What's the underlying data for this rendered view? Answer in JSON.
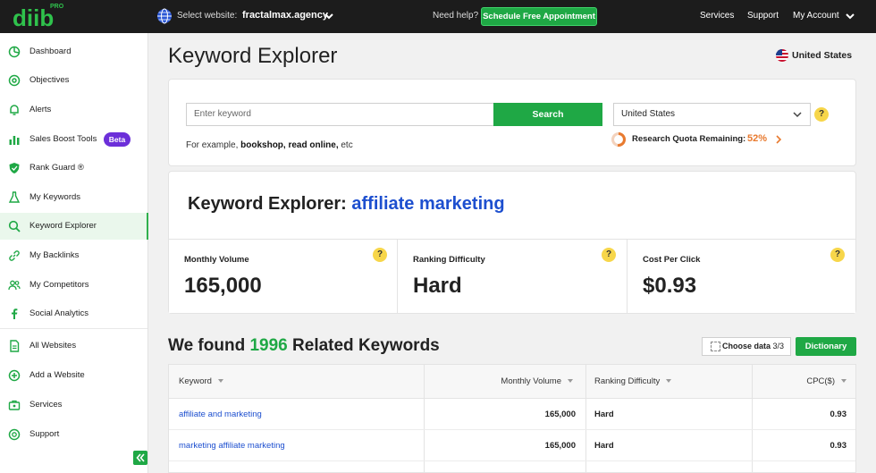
{
  "topbar": {
    "logo_text": "diib",
    "logo_badge": "PRO",
    "select_label": "Select website:",
    "website": "fractalmax.agency",
    "help_label": "Need help?",
    "appointment_button": "Schedule Free Appointment",
    "nav": [
      "Services",
      "Support",
      "My Account"
    ]
  },
  "sidebar": {
    "items": [
      {
        "label": "Dashboard",
        "icon": "dashboard-icon"
      },
      {
        "label": "Objectives",
        "icon": "target-icon"
      },
      {
        "label": "Alerts",
        "icon": "bell-icon"
      },
      {
        "label": "Sales Boost Tools",
        "icon": "bar-chart-icon",
        "badge": "Beta"
      },
      {
        "label": "Rank Guard ®",
        "icon": "shield-icon"
      },
      {
        "label": "My Keywords",
        "icon": "flask-icon"
      },
      {
        "label": "Keyword Explorer",
        "icon": "search-icon",
        "active": true
      },
      {
        "label": "My Backlinks",
        "icon": "link-icon"
      },
      {
        "label": "My Competitors",
        "icon": "users-icon"
      },
      {
        "label": "Social Analytics",
        "icon": "facebook-icon"
      },
      {
        "label": "All Websites",
        "icon": "document-icon"
      },
      {
        "label": "Add a Website",
        "icon": "plus-circle-icon"
      },
      {
        "label": "Services",
        "icon": "briefcase-icon"
      },
      {
        "label": "Support",
        "icon": "lifebuoy-icon"
      }
    ],
    "accent_color": "#1fa845",
    "beta_color": "#6c2fd9"
  },
  "page": {
    "title": "Keyword Explorer",
    "country": "United States"
  },
  "search": {
    "placeholder": "Enter keyword",
    "button": "Search",
    "example_prefix": "For example, ",
    "example_terms": "bookshop, read online,",
    "example_suffix": " etc",
    "country_select": "United States",
    "quota_label": "Research Quota Remaining:",
    "quota_value": "52%",
    "quota_fraction": 0.52
  },
  "result": {
    "heading_prefix": "Keyword Explorer:",
    "keyword": "affiliate marketing",
    "metrics": [
      {
        "label": "Monthly Volume",
        "value": "165,000"
      },
      {
        "label": "Ranking Difficulty",
        "value": "Hard"
      },
      {
        "label": "Cost Per Click",
        "value": "$0.93"
      }
    ],
    "help_glyph": "?"
  },
  "related": {
    "heading_prefix": "We found",
    "count": "1996",
    "heading_suffix": "Related Keywords",
    "choose_label": "Choose data",
    "choose_count": "3/3",
    "dictionary_button": "Dictionary",
    "columns": [
      "Keyword",
      "Monthly Volume",
      "Ranking Difficulty",
      "CPC($)"
    ],
    "rows": [
      {
        "keyword": "affiliate and marketing",
        "volume": "165,000",
        "difficulty": "Hard",
        "cpc": "0.93"
      },
      {
        "keyword": "marketing affiliate marketing",
        "volume": "165,000",
        "difficulty": "Hard",
        "cpc": "0.93"
      }
    ]
  }
}
